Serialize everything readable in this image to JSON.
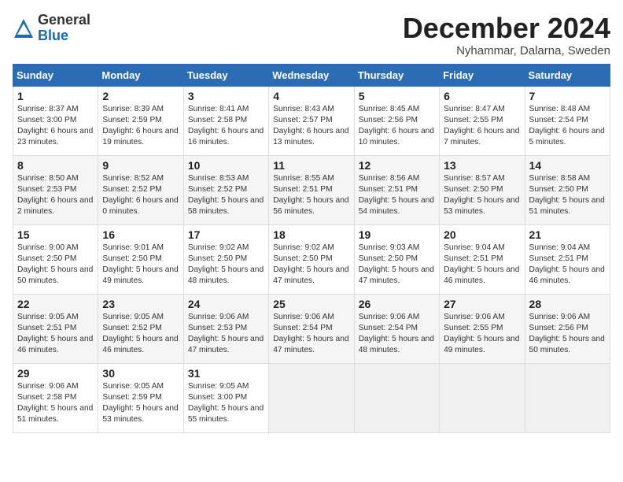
{
  "logo": {
    "general": "General",
    "blue": "Blue"
  },
  "title": "December 2024",
  "subtitle": "Nyhammar, Dalarna, Sweden",
  "days_header": [
    "Sunday",
    "Monday",
    "Tuesday",
    "Wednesday",
    "Thursday",
    "Friday",
    "Saturday"
  ],
  "weeks": [
    [
      {
        "day": "1",
        "sunrise": "Sunrise: 8:37 AM",
        "sunset": "Sunset: 3:00 PM",
        "daylight": "Daylight: 6 hours and 23 minutes."
      },
      {
        "day": "2",
        "sunrise": "Sunrise: 8:39 AM",
        "sunset": "Sunset: 2:59 PM",
        "daylight": "Daylight: 6 hours and 19 minutes."
      },
      {
        "day": "3",
        "sunrise": "Sunrise: 8:41 AM",
        "sunset": "Sunset: 2:58 PM",
        "daylight": "Daylight: 6 hours and 16 minutes."
      },
      {
        "day": "4",
        "sunrise": "Sunrise: 8:43 AM",
        "sunset": "Sunset: 2:57 PM",
        "daylight": "Daylight: 6 hours and 13 minutes."
      },
      {
        "day": "5",
        "sunrise": "Sunrise: 8:45 AM",
        "sunset": "Sunset: 2:56 PM",
        "daylight": "Daylight: 6 hours and 10 minutes."
      },
      {
        "day": "6",
        "sunrise": "Sunrise: 8:47 AM",
        "sunset": "Sunset: 2:55 PM",
        "daylight": "Daylight: 6 hours and 7 minutes."
      },
      {
        "day": "7",
        "sunrise": "Sunrise: 8:48 AM",
        "sunset": "Sunset: 2:54 PM",
        "daylight": "Daylight: 6 hours and 5 minutes."
      }
    ],
    [
      {
        "day": "8",
        "sunrise": "Sunrise: 8:50 AM",
        "sunset": "Sunset: 2:53 PM",
        "daylight": "Daylight: 6 hours and 2 minutes."
      },
      {
        "day": "9",
        "sunrise": "Sunrise: 8:52 AM",
        "sunset": "Sunset: 2:52 PM",
        "daylight": "Daylight: 6 hours and 0 minutes."
      },
      {
        "day": "10",
        "sunrise": "Sunrise: 8:53 AM",
        "sunset": "Sunset: 2:52 PM",
        "daylight": "Daylight: 5 hours and 58 minutes."
      },
      {
        "day": "11",
        "sunrise": "Sunrise: 8:55 AM",
        "sunset": "Sunset: 2:51 PM",
        "daylight": "Daylight: 5 hours and 56 minutes."
      },
      {
        "day": "12",
        "sunrise": "Sunrise: 8:56 AM",
        "sunset": "Sunset: 2:51 PM",
        "daylight": "Daylight: 5 hours and 54 minutes."
      },
      {
        "day": "13",
        "sunrise": "Sunrise: 8:57 AM",
        "sunset": "Sunset: 2:50 PM",
        "daylight": "Daylight: 5 hours and 53 minutes."
      },
      {
        "day": "14",
        "sunrise": "Sunrise: 8:58 AM",
        "sunset": "Sunset: 2:50 PM",
        "daylight": "Daylight: 5 hours and 51 minutes."
      }
    ],
    [
      {
        "day": "15",
        "sunrise": "Sunrise: 9:00 AM",
        "sunset": "Sunset: 2:50 PM",
        "daylight": "Daylight: 5 hours and 50 minutes."
      },
      {
        "day": "16",
        "sunrise": "Sunrise: 9:01 AM",
        "sunset": "Sunset: 2:50 PM",
        "daylight": "Daylight: 5 hours and 49 minutes."
      },
      {
        "day": "17",
        "sunrise": "Sunrise: 9:02 AM",
        "sunset": "Sunset: 2:50 PM",
        "daylight": "Daylight: 5 hours and 48 minutes."
      },
      {
        "day": "18",
        "sunrise": "Sunrise: 9:02 AM",
        "sunset": "Sunset: 2:50 PM",
        "daylight": "Daylight: 5 hours and 47 minutes."
      },
      {
        "day": "19",
        "sunrise": "Sunrise: 9:03 AM",
        "sunset": "Sunset: 2:50 PM",
        "daylight": "Daylight: 5 hours and 47 minutes."
      },
      {
        "day": "20",
        "sunrise": "Sunrise: 9:04 AM",
        "sunset": "Sunset: 2:51 PM",
        "daylight": "Daylight: 5 hours and 46 minutes."
      },
      {
        "day": "21",
        "sunrise": "Sunrise: 9:04 AM",
        "sunset": "Sunset: 2:51 PM",
        "daylight": "Daylight: 5 hours and 46 minutes."
      }
    ],
    [
      {
        "day": "22",
        "sunrise": "Sunrise: 9:05 AM",
        "sunset": "Sunset: 2:51 PM",
        "daylight": "Daylight: 5 hours and 46 minutes."
      },
      {
        "day": "23",
        "sunrise": "Sunrise: 9:05 AM",
        "sunset": "Sunset: 2:52 PM",
        "daylight": "Daylight: 5 hours and 46 minutes."
      },
      {
        "day": "24",
        "sunrise": "Sunrise: 9:06 AM",
        "sunset": "Sunset: 2:53 PM",
        "daylight": "Daylight: 5 hours and 47 minutes."
      },
      {
        "day": "25",
        "sunrise": "Sunrise: 9:06 AM",
        "sunset": "Sunset: 2:54 PM",
        "daylight": "Daylight: 5 hours and 47 minutes."
      },
      {
        "day": "26",
        "sunrise": "Sunrise: 9:06 AM",
        "sunset": "Sunset: 2:54 PM",
        "daylight": "Daylight: 5 hours and 48 minutes."
      },
      {
        "day": "27",
        "sunrise": "Sunrise: 9:06 AM",
        "sunset": "Sunset: 2:55 PM",
        "daylight": "Daylight: 5 hours and 49 minutes."
      },
      {
        "day": "28",
        "sunrise": "Sunrise: 9:06 AM",
        "sunset": "Sunset: 2:56 PM",
        "daylight": "Daylight: 5 hours and 50 minutes."
      }
    ],
    [
      {
        "day": "29",
        "sunrise": "Sunrise: 9:06 AM",
        "sunset": "Sunset: 2:58 PM",
        "daylight": "Daylight: 5 hours and 51 minutes."
      },
      {
        "day": "30",
        "sunrise": "Sunrise: 9:05 AM",
        "sunset": "Sunset: 2:59 PM",
        "daylight": "Daylight: 5 hours and 53 minutes."
      },
      {
        "day": "31",
        "sunrise": "Sunrise: 9:05 AM",
        "sunset": "Sunset: 3:00 PM",
        "daylight": "Daylight: 5 hours and 55 minutes."
      },
      null,
      null,
      null,
      null
    ]
  ]
}
